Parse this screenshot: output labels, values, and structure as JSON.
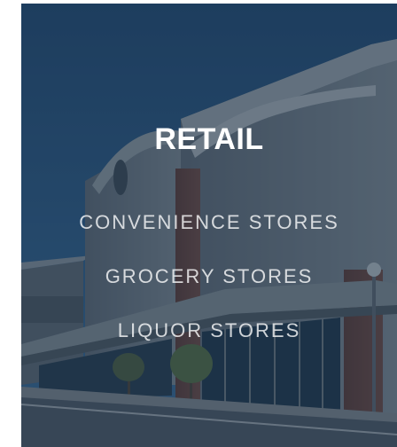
{
  "hero": {
    "heading": "RETAIL",
    "categories": [
      {
        "label": "CONVENIENCE STORES"
      },
      {
        "label": "GROCERY STORES"
      },
      {
        "label": "LIQUOR STORES"
      }
    ],
    "colors": {
      "overlay": "#193048",
      "text": "#ffffff"
    }
  }
}
